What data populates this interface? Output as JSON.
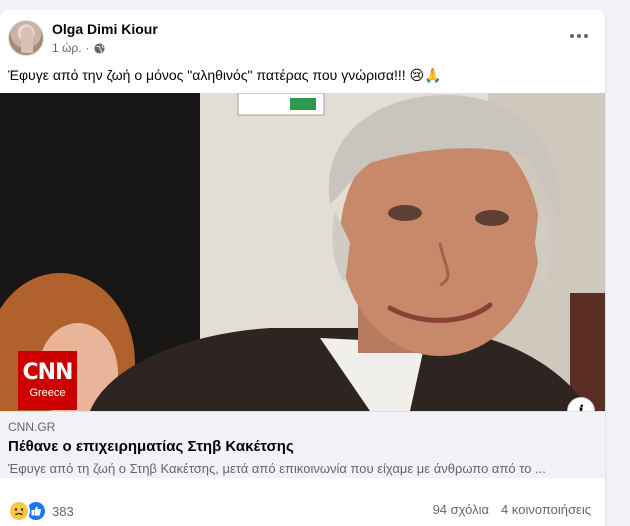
{
  "post": {
    "author": "Olga Dimi Kiour",
    "time": "1 ώρ.",
    "text": "Έφυγε από την ζωή ο μόνος \"αληθινός\" πατέρας που γνώρισα!!! 😢🙏"
  },
  "media": {
    "logo_brand": "CNN",
    "logo_sub": "Greece"
  },
  "link": {
    "domain": "CNN.GR",
    "title": "Πέθανε ο επιχειρηματίας Στηβ Κακέτσης",
    "description": "Έφυγε από τη ζωή ο Στηβ Κακέτσης, μετά από επικοινωνία που είχαμε με άνθρωπο από το ..."
  },
  "footer": {
    "reaction_count": "383",
    "comments": "94 σχόλια",
    "shares": "4 κοινοποιήσεις"
  },
  "colors": {
    "facebook_blue": "#1877f2",
    "cnn_red": "#cc0000",
    "muted_text": "#65676b"
  },
  "icons": [
    "globe-icon",
    "more-icon",
    "info-icon",
    "sad-reaction-icon",
    "like-reaction-icon"
  ]
}
